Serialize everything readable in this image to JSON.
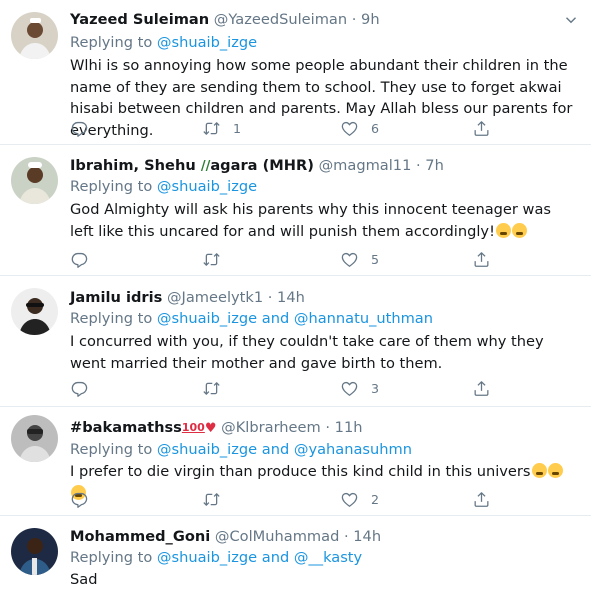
{
  "tweets": [
    {
      "name": "Yazeed Suleiman",
      "handle": "@YazeedSuleiman",
      "time": "9h",
      "replying_prefix": "Replying to ",
      "replying_to": "@shuaib_izge",
      "replying_and": "",
      "replying_to2": "",
      "body": "Wlhi is so annoying how some people abundant their children in the name of they are sending them to school. They use to forget akwai hisabi between children and parents. May Allah bless our parents for everything.",
      "retweets": "1",
      "likes": "6"
    },
    {
      "name": "Ibrahim, Shehu",
      "name_suffix": "agara (MHR)",
      "handle": "@magmal11",
      "time": "7h",
      "replying_prefix": "Replying to ",
      "replying_to": "@shuaib_izge",
      "body": "God Almighty will ask his parents why this innocent teenager was left like this uncared for and will punish them accordingly!",
      "retweets": "",
      "likes": "5"
    },
    {
      "name": "Jamilu idris",
      "handle": "@Jameelytk1",
      "time": "14h",
      "replying_prefix": "Replying to ",
      "replying_to": "@shuaib_izge",
      "replying_and": " and ",
      "replying_to2": "@hannatu_uthman",
      "body": "I concurred with you, if they couldn't take care of them why they went married their mother and gave birth to them.",
      "retweets": "",
      "likes": "3"
    },
    {
      "name": "#bakamathss",
      "handle": "@Klbrarheem",
      "time": "11h",
      "replying_prefix": "Replying to ",
      "replying_to": "@shuaib_izge",
      "replying_and": " and ",
      "replying_to2": "@yahanasuhmn",
      "body": "I prefer to die virgin than produce this kind child in this univers",
      "retweets": "",
      "likes": "2"
    },
    {
      "name": "Mohammed_Goni",
      "handle": "@ColMuhammad",
      "time": "14h",
      "replying_prefix": "Replying to ",
      "replying_to": "@shuaib_izge",
      "replying_and": " and ",
      "replying_to2": "@__kasty",
      "body": "Sad"
    }
  ],
  "separator": " · ",
  "colors": {
    "link": "#1b95e0",
    "muted": "#657786",
    "text": "#14171a",
    "divider": "#e6ecf0"
  },
  "icons": [
    "reply-icon",
    "retweet-icon",
    "like-icon",
    "share-icon",
    "chevron-down-icon"
  ]
}
